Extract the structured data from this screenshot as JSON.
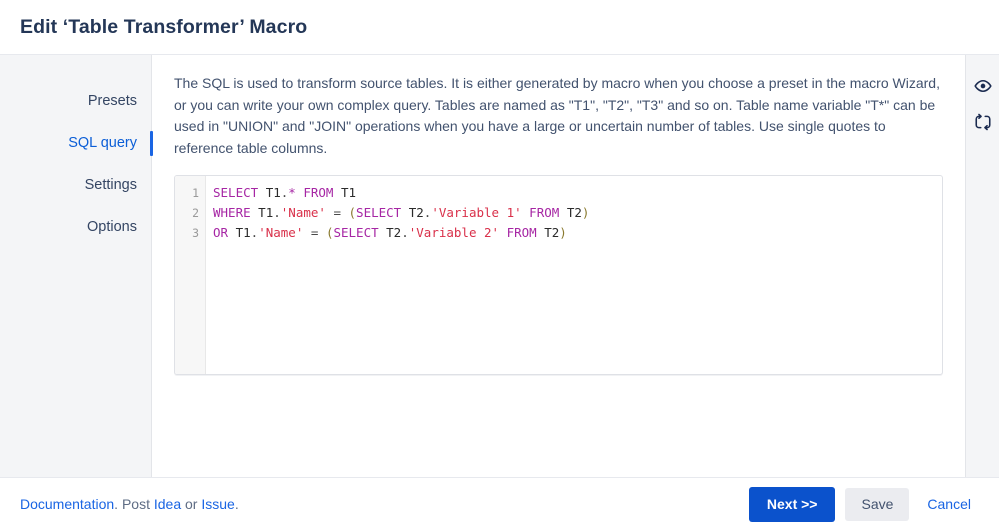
{
  "header": {
    "title": "Edit ‘Table Transformer’ Macro"
  },
  "nav": {
    "items": [
      {
        "label": "Presets",
        "active": false
      },
      {
        "label": "SQL query",
        "active": true
      },
      {
        "label": "Settings",
        "active": false
      },
      {
        "label": "Options",
        "active": false
      }
    ]
  },
  "main": {
    "description": "The SQL is used to transform source tables. It is either generated by macro when you choose a preset in the macro Wizard, or you can write your own complex query. Tables are named as \"T1\", \"T2\", \"T3\" and so on. Table name variable \"T*\" can be used in \"UNION\" and \"JOIN\" operations when you have a large or uncertain number of tables. Use single quotes to reference table columns.",
    "editor": {
      "line_numbers": [
        "1",
        "2",
        "3"
      ],
      "lines": [
        [
          {
            "t": "SELECT",
            "c": "kw"
          },
          {
            "t": " ",
            "c": "plain"
          },
          {
            "t": "T1",
            "c": "id"
          },
          {
            "t": ".",
            "c": "op"
          },
          {
            "t": "*",
            "c": "kw"
          },
          {
            "t": " ",
            "c": "plain"
          },
          {
            "t": "FROM",
            "c": "kw"
          },
          {
            "t": " ",
            "c": "plain"
          },
          {
            "t": "T1",
            "c": "id"
          }
        ],
        [
          {
            "t": "WHERE",
            "c": "kw"
          },
          {
            "t": " ",
            "c": "plain"
          },
          {
            "t": "T1",
            "c": "id"
          },
          {
            "t": ".",
            "c": "op"
          },
          {
            "t": "'Name'",
            "c": "str"
          },
          {
            "t": " ",
            "c": "plain"
          },
          {
            "t": "=",
            "c": "op"
          },
          {
            "t": " ",
            "c": "plain"
          },
          {
            "t": "(",
            "c": "punc"
          },
          {
            "t": "SELECT",
            "c": "kw"
          },
          {
            "t": " ",
            "c": "plain"
          },
          {
            "t": "T2",
            "c": "id"
          },
          {
            "t": ".",
            "c": "op"
          },
          {
            "t": "'Variable 1'",
            "c": "str"
          },
          {
            "t": " ",
            "c": "plain"
          },
          {
            "t": "FROM",
            "c": "kw"
          },
          {
            "t": " ",
            "c": "plain"
          },
          {
            "t": "T2",
            "c": "id"
          },
          {
            "t": ")",
            "c": "punc"
          }
        ],
        [
          {
            "t": "OR",
            "c": "kw"
          },
          {
            "t": " ",
            "c": "plain"
          },
          {
            "t": "T1",
            "c": "id"
          },
          {
            "t": ".",
            "c": "op"
          },
          {
            "t": "'Name'",
            "c": "str"
          },
          {
            "t": " ",
            "c": "plain"
          },
          {
            "t": "=",
            "c": "op"
          },
          {
            "t": " ",
            "c": "plain"
          },
          {
            "t": "(",
            "c": "punc"
          },
          {
            "t": "SELECT",
            "c": "kw"
          },
          {
            "t": " ",
            "c": "plain"
          },
          {
            "t": "T2",
            "c": "id"
          },
          {
            "t": ".",
            "c": "op"
          },
          {
            "t": "'Variable 2'",
            "c": "str"
          },
          {
            "t": " ",
            "c": "plain"
          },
          {
            "t": "FROM",
            "c": "kw"
          },
          {
            "t": " ",
            "c": "plain"
          },
          {
            "t": "T2",
            "c": "id"
          },
          {
            "t": ")",
            "c": "punc"
          }
        ]
      ],
      "plain_text": "SELECT T1.* FROM T1\nWHERE T1.'Name' = (SELECT T2.'Variable 1' FROM T2)\nOR T1.'Name' = (SELECT T2.'Variable 2' FROM T2)"
    }
  },
  "rail": {
    "icons": [
      {
        "name": "eye-icon",
        "title": "Preview"
      },
      {
        "name": "refresh-icon",
        "title": "Refresh"
      }
    ]
  },
  "footer": {
    "links": {
      "documentation": "Documentation",
      "sep1": ". Post ",
      "idea": "Idea",
      "sep2": " or ",
      "issue": "Issue",
      "sep3": "."
    },
    "buttons": {
      "next": "Next >>",
      "save": "Save",
      "cancel": "Cancel"
    }
  },
  "colors": {
    "accent": "#0b52cc",
    "link": "#1a65e3",
    "sidebar_bg": "#f4f5f7",
    "keyword": "#a626a4",
    "string": "#d9304a",
    "punctuation": "#8a7a2f",
    "title": "#243757"
  }
}
